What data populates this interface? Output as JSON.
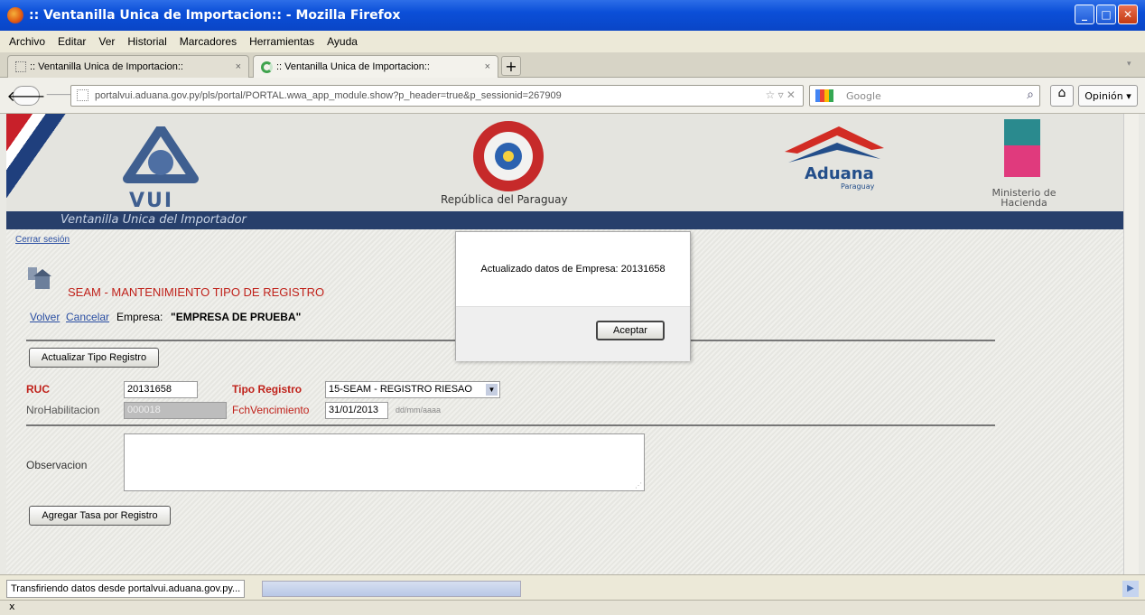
{
  "window": {
    "title": ":: Ventanilla Unica de Importacion:: - Mozilla Firefox"
  },
  "menu": [
    "Archivo",
    "Editar",
    "Ver",
    "Historial",
    "Marcadores",
    "Herramientas",
    "Ayuda"
  ],
  "tabs": [
    {
      "label": ":: Ventanilla Unica de Importacion::"
    },
    {
      "label": ":: Ventanilla Unica de Importacion::"
    }
  ],
  "nav": {
    "url": "portalvui.aduana.gov.py/pls/portal/PORTAL.wwa_app_module.show?p_header=true&p_sessionid=267909",
    "search_placeholder": "Google",
    "opinion": "Opinión"
  },
  "banner": {
    "vui_logo_text": "VUI",
    "republica": "República del Paraguay",
    "aduana": "Aduana",
    "aduana_sub": "Paraguay",
    "ministerio": "Ministerio de Hacienda",
    "strip": "Ventanilla Unica del Importador"
  },
  "page": {
    "logout": "Cerrar sesión",
    "title": "SEAM - MANTENIMIENTO TIPO DE REGISTRO",
    "back": "Volver",
    "cancel": "Cancelar",
    "empresa_label": "Empresa:",
    "empresa_value": "\"EMPRESA DE PRUEBA\"",
    "update_btn": "Actualizar Tipo Registro",
    "ruc_label": "RUC",
    "ruc_value": "20131658",
    "tipo_label": "Tipo Registro",
    "tipo_value": "15-SEAM - REGISTRO RIESAO",
    "nro_label": "NroHabilitacion",
    "nro_value": "000018",
    "fch_label": "FchVencimiento",
    "fch_value": "31/01/2013",
    "fch_format": "dd/mm/aaaa",
    "obs_label": "Observacion",
    "add_btn": "Agregar Tasa por Registro"
  },
  "modal": {
    "message": "Actualizado datos de Empresa: 20131658",
    "accept": "Aceptar"
  },
  "status": {
    "text": "Transfiriendo datos desde portalvui.aduana.gov.py...",
    "close": "x"
  }
}
